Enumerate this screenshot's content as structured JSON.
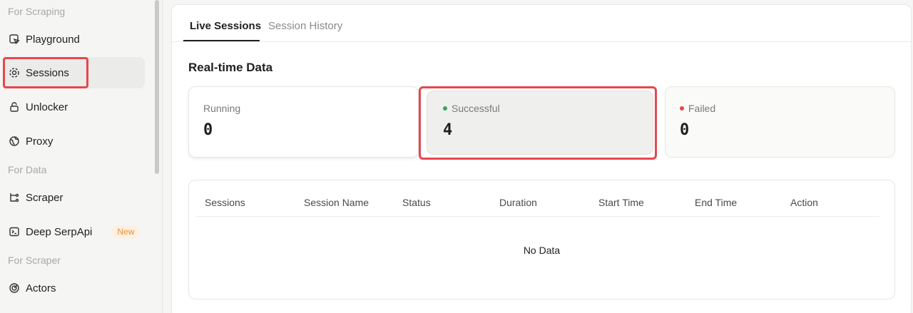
{
  "sidebar": {
    "sections": [
      "For Scraping",
      "For Data",
      "For Scraper"
    ],
    "items": [
      {
        "label": "Playground",
        "icon": "playground-icon"
      },
      {
        "label": "Sessions",
        "icon": "sessions-icon"
      },
      {
        "label": "Unlocker",
        "icon": "unlock-icon"
      },
      {
        "label": "Proxy",
        "icon": "globe-icon"
      },
      {
        "label": "Scraper",
        "icon": "scraper-icon"
      },
      {
        "label": "Deep SerpApi",
        "icon": "terminal-icon",
        "badge": "New"
      },
      {
        "label": "Actors",
        "icon": "actors-icon"
      }
    ],
    "active_item": "Sessions"
  },
  "tabs": {
    "live": "Live Sessions",
    "history": "Session History"
  },
  "realtime": {
    "title": "Real-time Data",
    "running": {
      "label": "Running",
      "value": "0"
    },
    "successful": {
      "label": "Successful",
      "value": "4",
      "dot_color": "#34a853"
    },
    "failed": {
      "label": "Failed",
      "value": "0",
      "dot_color": "#e5484d"
    }
  },
  "table": {
    "columns": [
      "Sessions",
      "Session Name",
      "Status",
      "Duration",
      "Start Time",
      "End Time",
      "Action"
    ],
    "empty_text": "No Data"
  },
  "colors": {
    "highlight": "#e5484d",
    "badge_text": "#e8913a",
    "badge_bg": "#fdf0e1"
  }
}
